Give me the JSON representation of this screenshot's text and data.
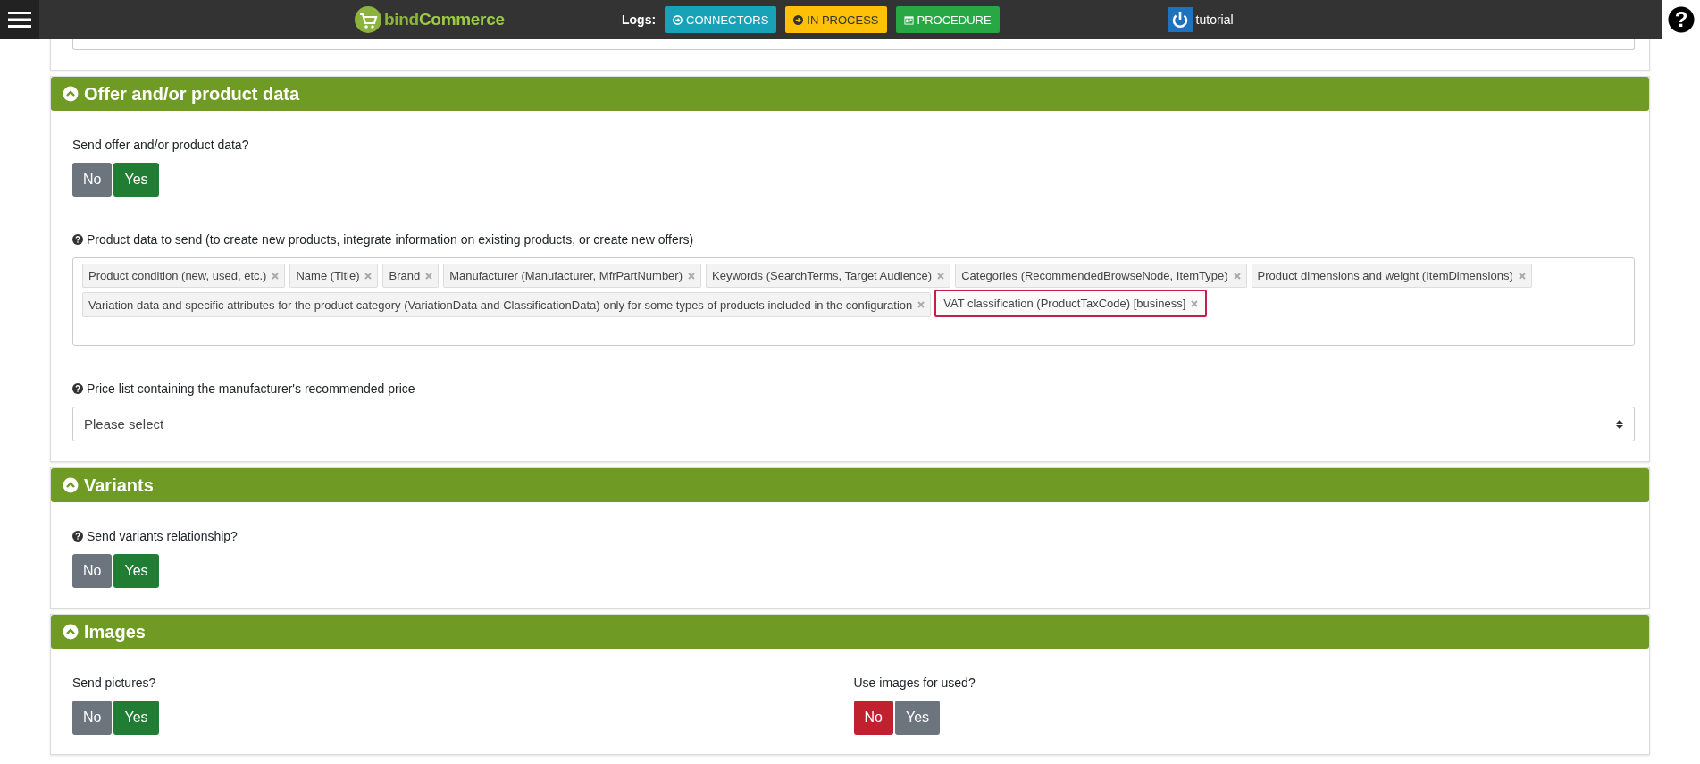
{
  "topbar": {
    "logo": {
      "first": "bind",
      "second": "Commerce"
    },
    "logs_label": "Logs:",
    "log_buttons": [
      {
        "label": "CONNECTORS",
        "kind": "connectors",
        "color": "#17a2b8"
      },
      {
        "label": "IN PROCESS",
        "kind": "process",
        "color": "#ffc107"
      },
      {
        "label": "PROCEDURE",
        "kind": "procedure",
        "color": "#28a745"
      }
    ],
    "user": "tutorial",
    "help": "?"
  },
  "sections": [
    {
      "title": "Offer and/or product data",
      "expanded": true,
      "fields": [
        {
          "kind": "toggle",
          "label": "Send offer and/or product data?",
          "help": false,
          "options": [
            {
              "label": "No",
              "selected": false
            },
            {
              "label": "Yes",
              "selected": true
            }
          ]
        },
        {
          "kind": "tags",
          "label": "Product data to send (to create new products, integrate information on existing products, or create new offers)",
          "help": true,
          "tags": [
            {
              "label": "Product condition (new, used, etc.)",
              "highlighted": false
            },
            {
              "label": "Name (Title)",
              "highlighted": false
            },
            {
              "label": "Brand",
              "highlighted": false
            },
            {
              "label": "Manufacturer (Manufacturer, MfrPartNumber)",
              "highlighted": false
            },
            {
              "label": "Keywords (SearchTerms, Target Audience)",
              "highlighted": false
            },
            {
              "label": "Categories (RecommendedBrowseNode, ItemType)",
              "highlighted": false
            },
            {
              "label": "Product dimensions and weight (ItemDimensions)",
              "highlighted": false
            },
            {
              "label": "Variation data and specific attributes for the product category (VariationData and ClassificationData) only for some types of products included in the configuration",
              "highlighted": false
            },
            {
              "label": "VAT classification (ProductTaxCode) [business]",
              "highlighted": true
            }
          ]
        },
        {
          "kind": "select",
          "label": "Price list containing the manufacturer's recommended price",
          "help": true,
          "placeholder": "Please select"
        }
      ]
    },
    {
      "title": "Variants",
      "expanded": true,
      "fields": [
        {
          "kind": "toggle",
          "label": "Send variants relationship?",
          "help": true,
          "options": [
            {
              "label": "No",
              "selected": false
            },
            {
              "label": "Yes",
              "selected": true
            }
          ]
        }
      ]
    },
    {
      "title": "Images",
      "expanded": true,
      "fields": [
        {
          "kind": "row",
          "fields": [
            {
              "kind": "toggle",
              "label": "Send pictures?",
              "help": false,
              "options": [
                {
                  "label": "No",
                  "selected": false
                },
                {
                  "label": "Yes",
                  "selected": true
                }
              ]
            },
            {
              "kind": "toggle",
              "label": "Use images for used?",
              "help": false,
              "options": [
                {
                  "label": "No",
                  "selected": true
                },
                {
                  "label": "Yes",
                  "selected": false
                }
              ]
            }
          ]
        }
      ]
    }
  ]
}
